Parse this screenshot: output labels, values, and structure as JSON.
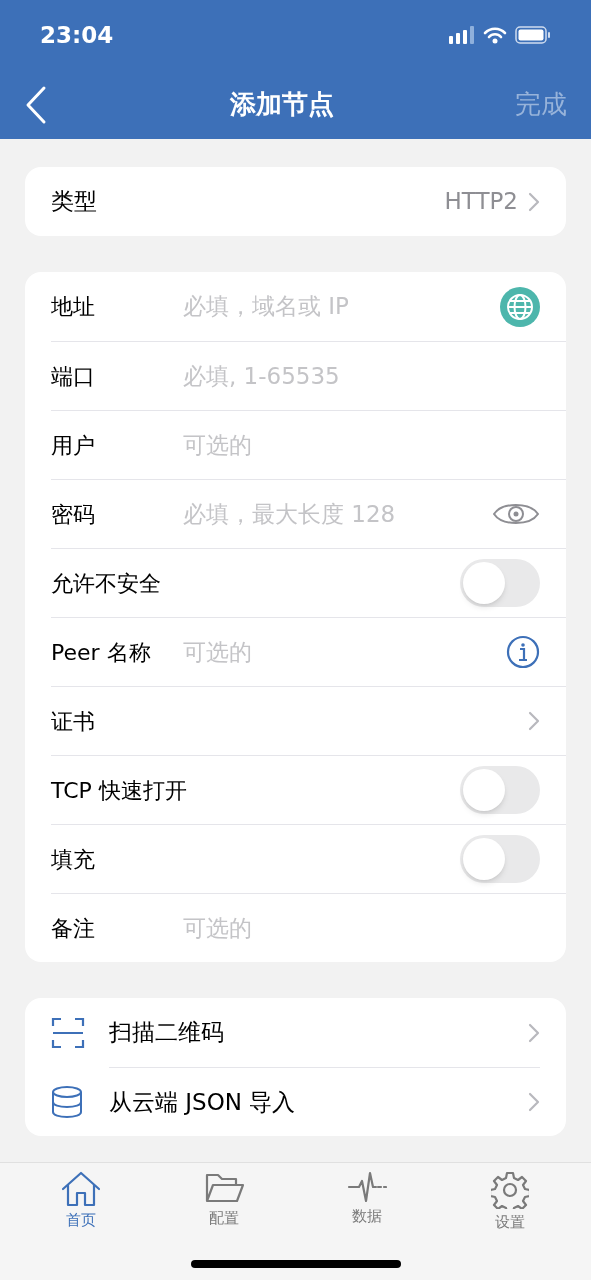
{
  "status_bar": {
    "time": "23:04"
  },
  "nav": {
    "title": "添加节点",
    "done": "完成",
    "done_disabled": true
  },
  "type_row": {
    "label": "类型",
    "value": "HTTP2"
  },
  "fields": [
    {
      "kind": "input",
      "label": "地址",
      "placeholder": "必填，域名或 IP"
    },
    {
      "kind": "input",
      "label": "端口",
      "placeholder": "必填, 1-65535"
    },
    {
      "kind": "input",
      "label": "用户",
      "placeholder": "可选的"
    },
    {
      "kind": "input",
      "label": "密码",
      "placeholder": "必填，最大长度 128"
    },
    {
      "kind": "toggle",
      "label": "允许不安全",
      "on": false
    },
    {
      "kind": "input",
      "label": "Peer 名称",
      "placeholder": "可选的"
    },
    {
      "kind": "link",
      "label": "证书"
    },
    {
      "kind": "toggle",
      "label": "TCP 快速打开",
      "on": false
    },
    {
      "kind": "toggle",
      "label": "填充",
      "on": false
    },
    {
      "kind": "input",
      "label": "备注",
      "placeholder": "可选的"
    }
  ],
  "actions": [
    {
      "label": "扫描二维码"
    },
    {
      "label": "从云端 JSON 导入"
    }
  ],
  "tabs": [
    {
      "label": "首页",
      "selected": true
    },
    {
      "label": "配置",
      "selected": false
    },
    {
      "label": "数据",
      "selected": false
    },
    {
      "label": "设置",
      "selected": false
    }
  ]
}
